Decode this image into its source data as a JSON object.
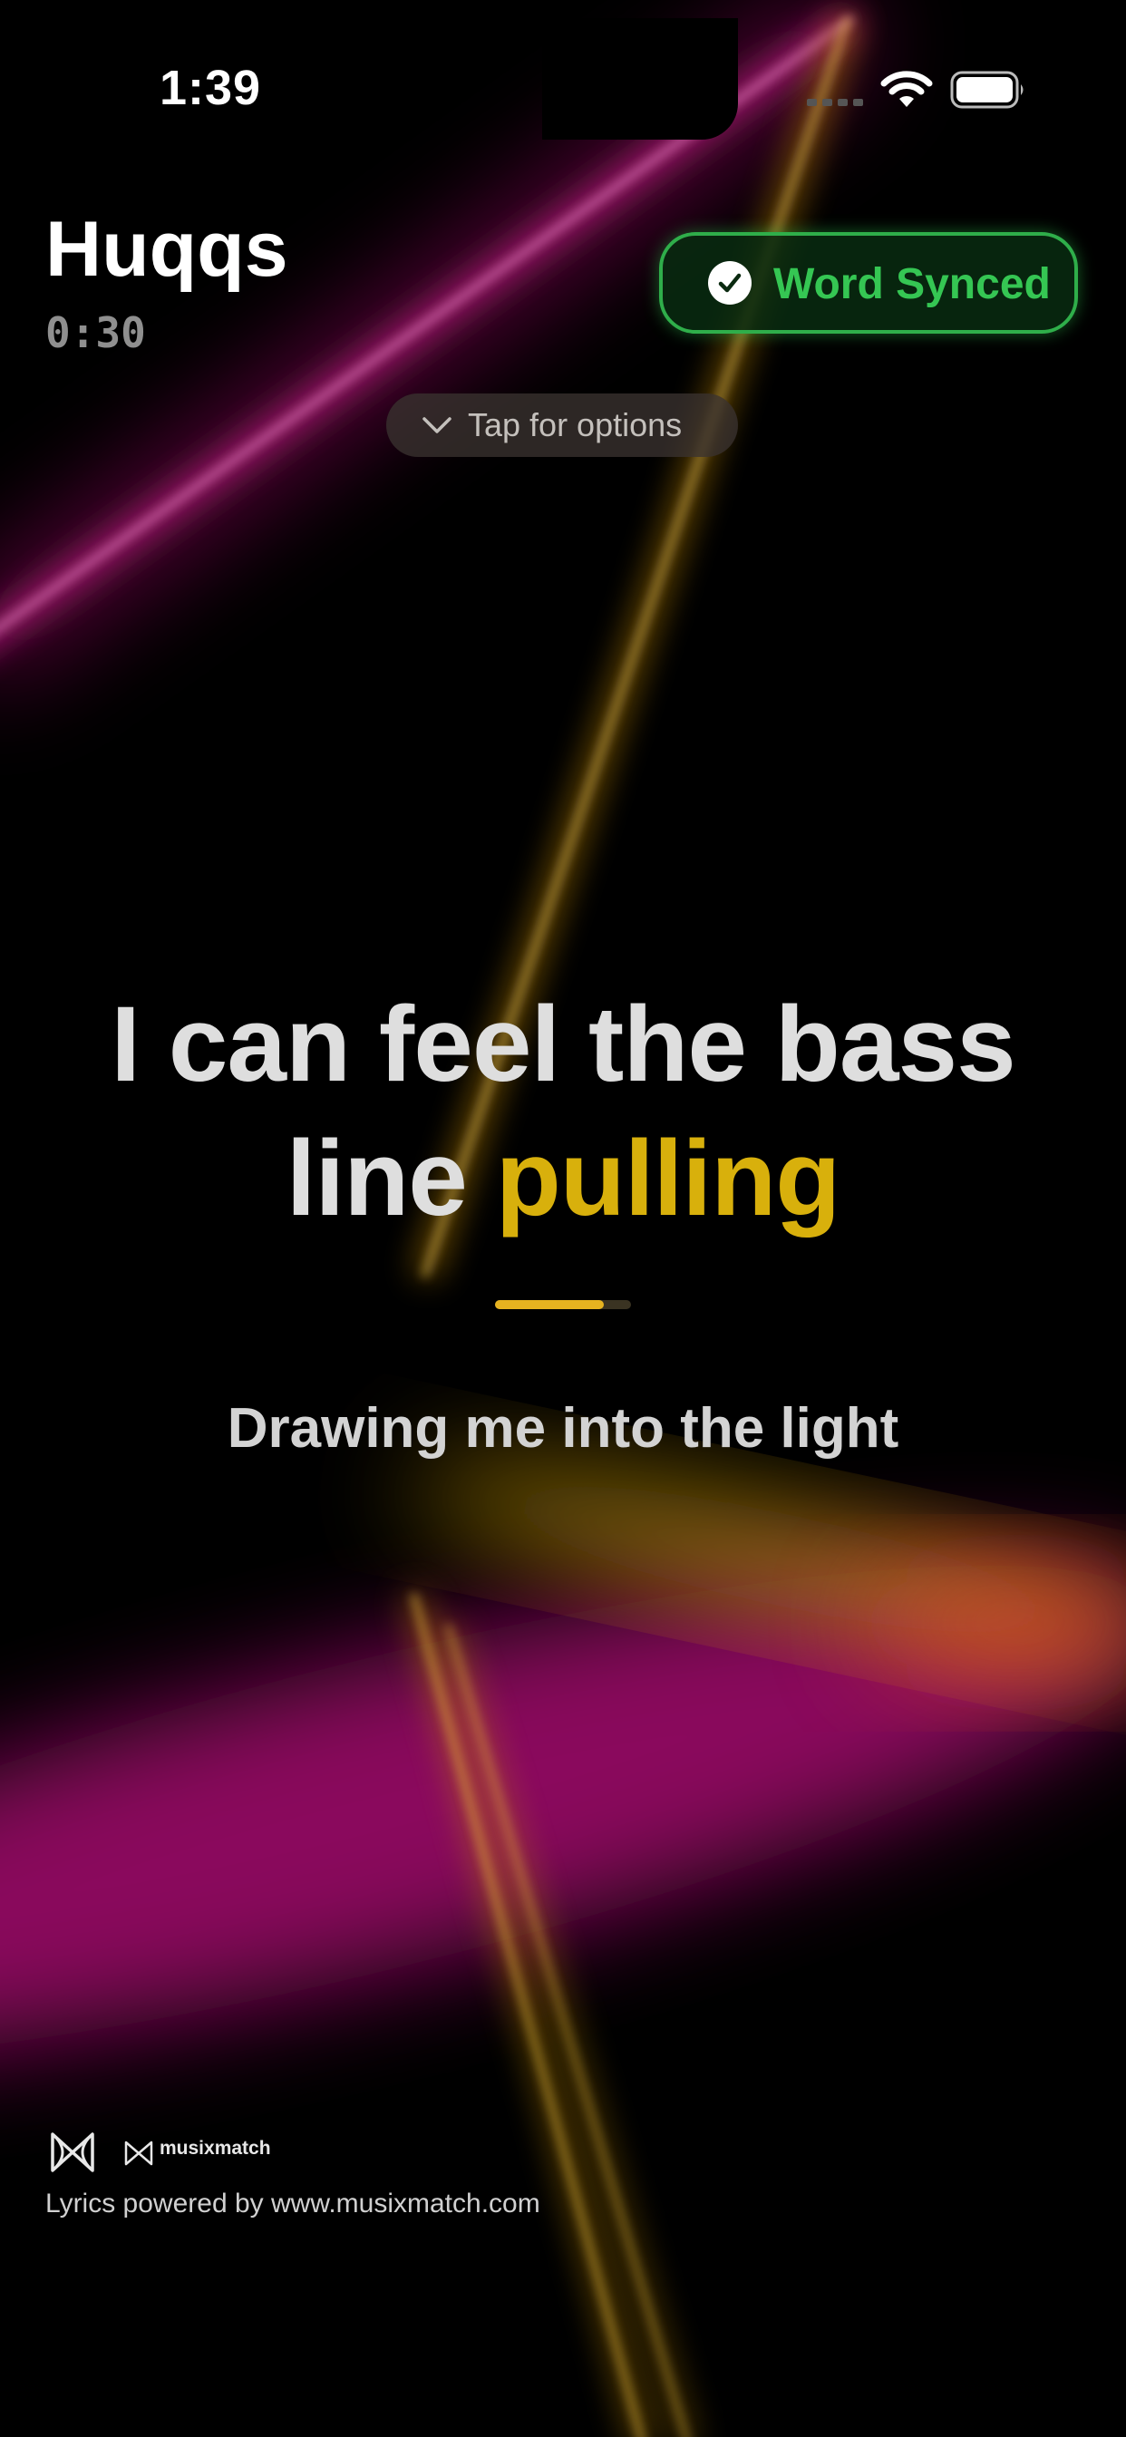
{
  "status_bar": {
    "time": "1:39",
    "wifi_icon": "wifi-icon",
    "battery_icon": "battery-icon"
  },
  "header": {
    "title": "Huqqs",
    "timer": "0:30"
  },
  "sync_badge": {
    "label": "Word Synced",
    "icon": "checkmark-icon",
    "color": "#35c653"
  },
  "options": {
    "label": "Tap for options",
    "icon": "chevron-down-icon"
  },
  "lyrics": {
    "current_line_plain": "I can feel the bass line",
    "current_line_highlight": "pulling",
    "highlight_color": "#d8b00c",
    "word_progress": 0.8,
    "next_line": "Drawing me into the light"
  },
  "footer": {
    "brand_wordmark": "musixmatch",
    "credit": "Lyrics powered by www.musixmatch.com"
  },
  "colors": {
    "background": "#000000",
    "laser_pink": "#e0209a",
    "laser_yellow": "#e8b820"
  }
}
